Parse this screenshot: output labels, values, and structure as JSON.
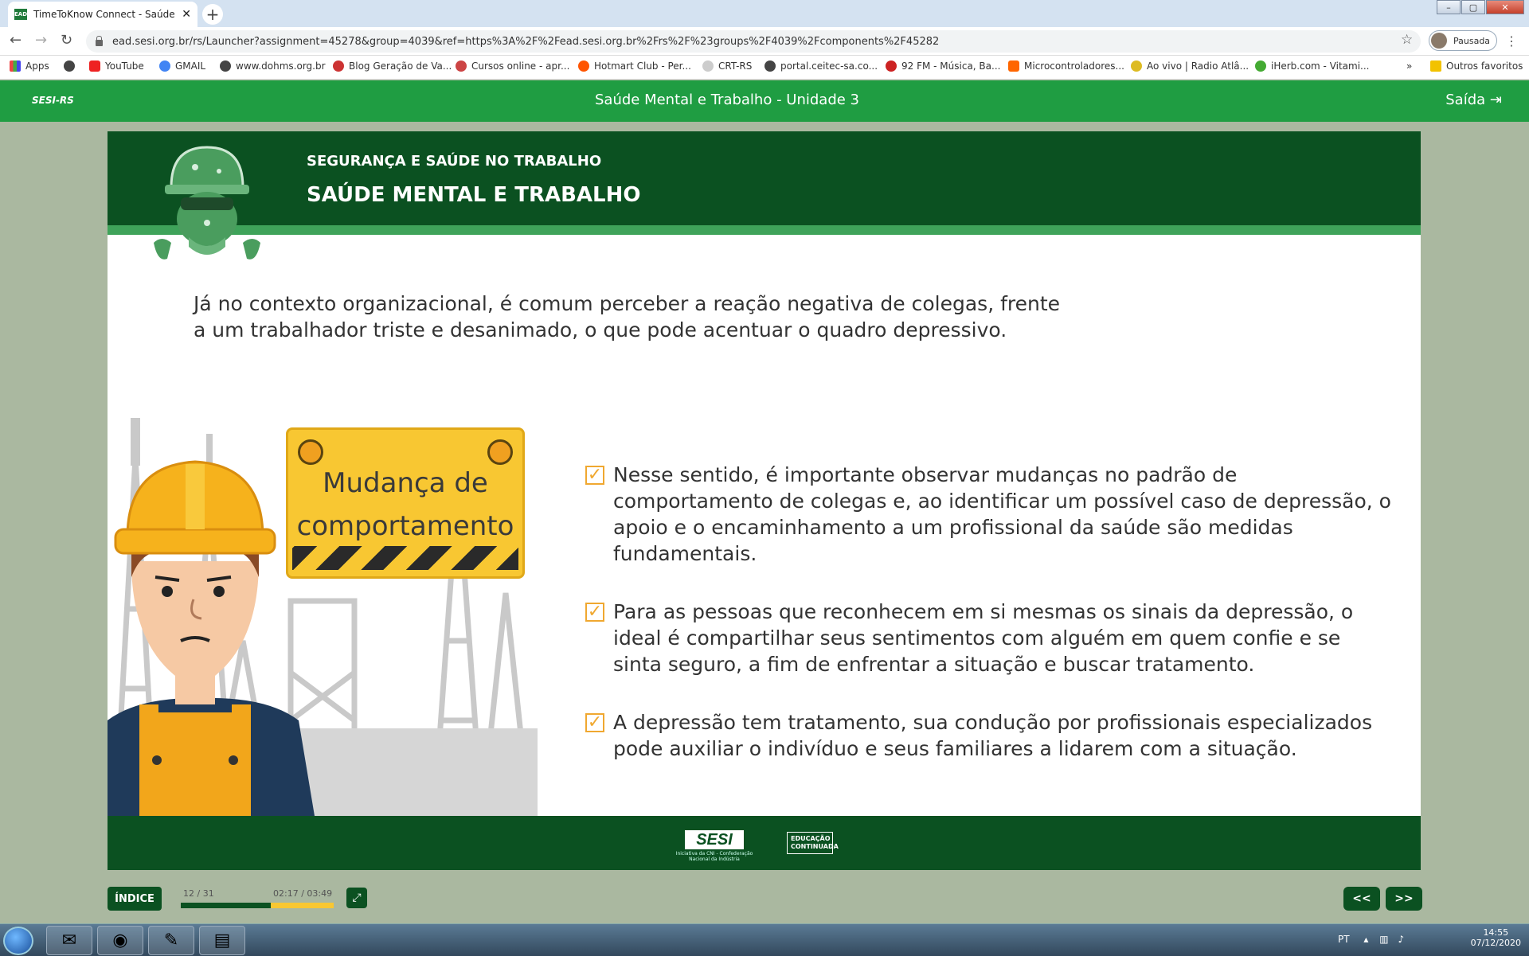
{
  "browser": {
    "tab_title": "TimeToKnow Connect - Saúde M",
    "tab_favicon": "EAD",
    "url": "ead.sesi.org.br/rs/Launcher?assignment=45278&group=4039&ref=https%3A%2F%2Fead.sesi.org.br%2Frs%2F%23groups%2F4039%2Fcomponents%2F45282",
    "profile_label": "Pausada",
    "bookmarks": [
      "Apps",
      "YouTube",
      "GMAIL",
      "www.dohms.org.br",
      "Blog Geração de Va...",
      "Cursos online - apr...",
      "Hotmart Club - Per...",
      "CRT-RS",
      "portal.ceitec-sa.co...",
      "92 FM - Música, Ba...",
      "Microcontroladores...",
      "Ao vivo | Radio Atlâ...",
      "iHerb.com - Vitami..."
    ],
    "bookmarks_more": "»",
    "other_bookmarks": "Outros favoritos"
  },
  "app": {
    "brand": "SESI-RS",
    "course_title": "Saúde Mental e Trabalho - Unidade 3",
    "exit_label": "Saída"
  },
  "slide": {
    "supertitle": "SEGURANÇA E SAÚDE NO TRABALHO",
    "title": "SAÚDE MENTAL E TRABALHO",
    "intro_line1": "Já no contexto organizacional, é comum perceber a reação negativa de colegas, frente",
    "intro_line2": "a um trabalhador triste e desanimado, o que pode acentuar o quadro depressivo.",
    "sign_line1": "Mudança de",
    "sign_line2": "comportamento",
    "bullets": [
      "Nesse sentido, é importante observar mudanças no padrão de comportamento de colegas e, ao identificar um possível caso de depressão, o apoio e o encaminhamento a um profissional da saúde são medidas fundamentais.",
      "Para as pessoas que reconhecem em si mesmas os sinais da depressão, o ideal é compartilhar seus sentimentos com alguém em quem confie e se sinta seguro, a fim de enfrentar a situação e buscar tratamento.",
      "A depressão tem tratamento, sua condução por profissionais especializados pode auxiliar o indivíduo e seus familiares a lidarem com a situação."
    ],
    "footer_logo": "SESI",
    "footer_logo_sub": "Iniciativa da CNI - Confederação Nacional da Indústria",
    "footer_educ_line1": "EDUCAÇÃO",
    "footer_educ_line2": "CONTINUADA"
  },
  "controls": {
    "index_label": "ÍNDICE",
    "page": "12 / 31",
    "time": "02:17 / 03:49",
    "progress_fraction": 0.59,
    "prev_label": "<<",
    "next_label": ">>"
  },
  "taskbar": {
    "language": "PT",
    "time": "14:55",
    "date": "07/12/2020"
  },
  "colors": {
    "app_green": "#1f9d42",
    "dark_green": "#0b5121",
    "accent_orange": "#f0a830",
    "sign_yellow": "#f8c732"
  }
}
